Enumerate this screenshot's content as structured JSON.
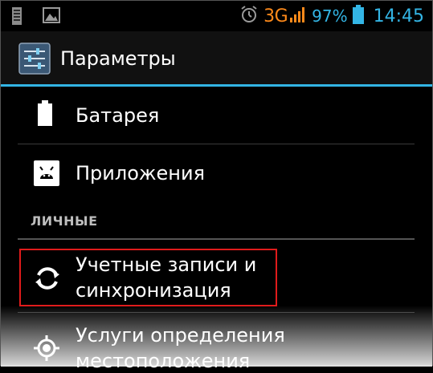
{
  "status_bar": {
    "network": "3G",
    "battery_percent": "97%",
    "time": "14:45",
    "icons": [
      "usb-debug-icon",
      "image-icon",
      "alarm-icon",
      "signal-icon",
      "battery-icon"
    ]
  },
  "action_bar": {
    "title": "Параметры",
    "icon": "settings-sliders-icon"
  },
  "items": [
    {
      "label": "Батарея",
      "icon": "battery-icon"
    },
    {
      "label": "Приложения",
      "icon": "apps-icon"
    }
  ],
  "section": {
    "header": "ЛИЧНЫЕ"
  },
  "personal_items": [
    {
      "label_line1": "Учетные записи и",
      "label_line2": "синхронизация",
      "icon": "sync-icon"
    },
    {
      "label_line1": "Услуги определения",
      "label_line2": "местоположения",
      "icon": "location-icon"
    }
  ],
  "colors": {
    "accent": "#33b5e5",
    "network": "#ff8a1a",
    "highlight": "#e01b1b"
  }
}
